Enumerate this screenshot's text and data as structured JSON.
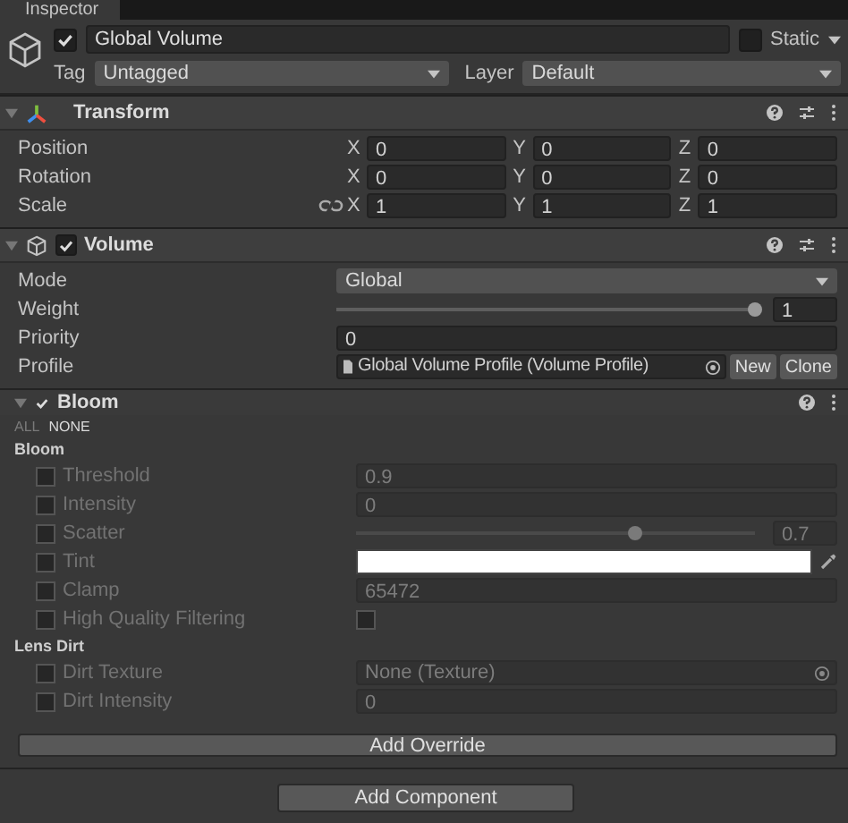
{
  "tab": {
    "title": "Inspector"
  },
  "object": {
    "active": true,
    "name": "Global Volume",
    "static": false,
    "static_label": "Static",
    "tag_label": "Tag",
    "tag": "Untagged",
    "layer_label": "Layer",
    "layer": "Default"
  },
  "transform": {
    "title": "Transform",
    "expanded": true,
    "rows": [
      {
        "label": "Position",
        "link_toggle": false,
        "values": [
          {
            "axis": "X",
            "value": "0"
          },
          {
            "axis": "Y",
            "value": "0"
          },
          {
            "axis": "Z",
            "value": "0"
          }
        ]
      },
      {
        "label": "Rotation",
        "link_toggle": false,
        "values": [
          {
            "axis": "X",
            "value": "0"
          },
          {
            "axis": "Y",
            "value": "0"
          },
          {
            "axis": "Z",
            "value": "0"
          }
        ]
      },
      {
        "label": "Scale",
        "link_toggle": true,
        "values": [
          {
            "axis": "X",
            "value": "1"
          },
          {
            "axis": "Y",
            "value": "1"
          },
          {
            "axis": "Z",
            "value": "1"
          }
        ]
      }
    ]
  },
  "volume": {
    "title": "Volume",
    "enabled": true,
    "expanded": true,
    "fields": [
      {
        "kind": "dropdown",
        "label": "Mode",
        "value": "Global"
      },
      {
        "kind": "slider",
        "label": "Weight",
        "level": 1,
        "value": "1"
      },
      {
        "kind": "number",
        "label": "Priority",
        "value": "0"
      },
      {
        "kind": "asset",
        "label": "Profile",
        "value": "Global Volume Profile (Volume Profile)",
        "buttons": [
          "New",
          "Clone"
        ]
      }
    ]
  },
  "override": {
    "title": "Bloom",
    "enabled": true,
    "expanded": true,
    "toggle_all": "ALL",
    "toggle_none": "NONE",
    "groups": [
      {
        "title": "Bloom",
        "fields": [
          {
            "kind": "number",
            "label": "Threshold",
            "overridden": false,
            "value": "0.9"
          },
          {
            "kind": "number",
            "label": "Intensity",
            "overridden": false,
            "value": "0"
          },
          {
            "kind": "slider",
            "label": "Scatter",
            "overridden": false,
            "level": 0.7,
            "value": "0.7"
          },
          {
            "kind": "color",
            "label": "Tint",
            "overridden": false,
            "color": "#ffffff"
          },
          {
            "kind": "number",
            "label": "Clamp",
            "overridden": false,
            "value": "65472"
          },
          {
            "kind": "checkbox",
            "label": "High Quality Filtering",
            "overridden": false,
            "checked": false
          }
        ]
      },
      {
        "title": "Lens Dirt",
        "fields": [
          {
            "kind": "object",
            "label": "Dirt Texture",
            "overridden": false,
            "value": "None (Texture)"
          },
          {
            "kind": "number",
            "label": "Dirt Intensity",
            "overridden": false,
            "value": "0"
          }
        ]
      }
    ],
    "add_override": "Add Override"
  },
  "add_component": "Add Component"
}
